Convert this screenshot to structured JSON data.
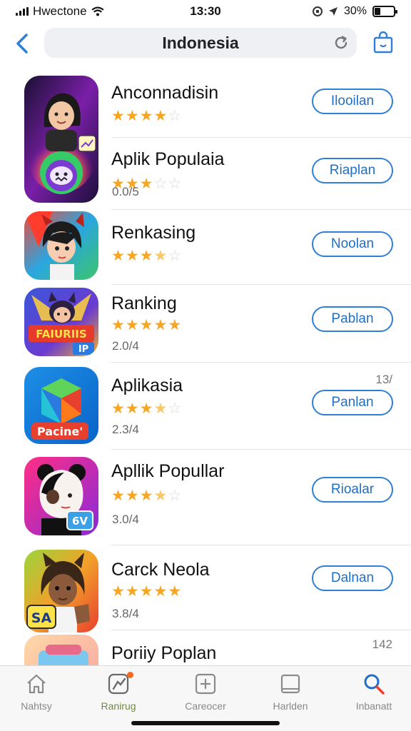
{
  "status_bar": {
    "carrier": "Hwectone",
    "time": "13:30",
    "battery_percent": "30%",
    "battery_level": 0.3,
    "icons": [
      "signal-icon",
      "wifi-icon",
      "lock-rotation-icon",
      "location-icon",
      "battery-icon"
    ]
  },
  "nav": {
    "title": "Indonesia",
    "icons": [
      "back-chevron-icon",
      "reload-icon",
      "shopping-bag-icon"
    ]
  },
  "apps": [
    {
      "name": "Anconnadisin",
      "rating": 4,
      "score": "",
      "button": "Ilooilan",
      "rank": ""
    },
    {
      "name": "Aplik Populaia",
      "rating": 3,
      "score": "0.0/5",
      "button": "Riaplan",
      "rank": ""
    },
    {
      "name": "Renkasing",
      "rating": 3.5,
      "score": "",
      "button": "Noolan",
      "rank": ""
    },
    {
      "name": "Ranking",
      "rating": 5,
      "score": "2.0/4",
      "button": "Pablan",
      "rank": ""
    },
    {
      "name": "Aplikasia",
      "rating": 3.5,
      "score": "2.3/4",
      "button": "Panlan",
      "rank": "13/"
    },
    {
      "name": "Apllik Popullar",
      "rating": 3.5,
      "score": "3.0/4",
      "button": "Rioalar",
      "rank": ""
    },
    {
      "name": "Carck Neola",
      "rating": 5,
      "score": "3.8/4",
      "button": "Dalnan",
      "rank": ""
    },
    {
      "name": "Poriiy Poplan",
      "rating": 0,
      "score": "",
      "button": "",
      "rank": "142"
    }
  ],
  "icon_labels": {
    "app_3": "FAIURIIS",
    "app_3_badge": "IP",
    "app_4": "Pacine'",
    "app_5_badge": "6V",
    "app_6": "SA"
  },
  "tabs": [
    {
      "label": "Nahtsy",
      "icon": "home-icon",
      "active": false
    },
    {
      "label": "Ranirug",
      "icon": "ranking-icon",
      "active": true,
      "badge": true
    },
    {
      "label": "Careocer",
      "icon": "add-square-icon",
      "active": false
    },
    {
      "label": "Harlden",
      "icon": "tablet-icon",
      "active": false
    },
    {
      "label": "Inbanatt",
      "icon": "search-icon",
      "active": false
    }
  ],
  "colors": {
    "accent": "#2f7fd8",
    "star": "#f5a623",
    "active_tab": "#6e8a3d",
    "badge": "#f26b21"
  }
}
